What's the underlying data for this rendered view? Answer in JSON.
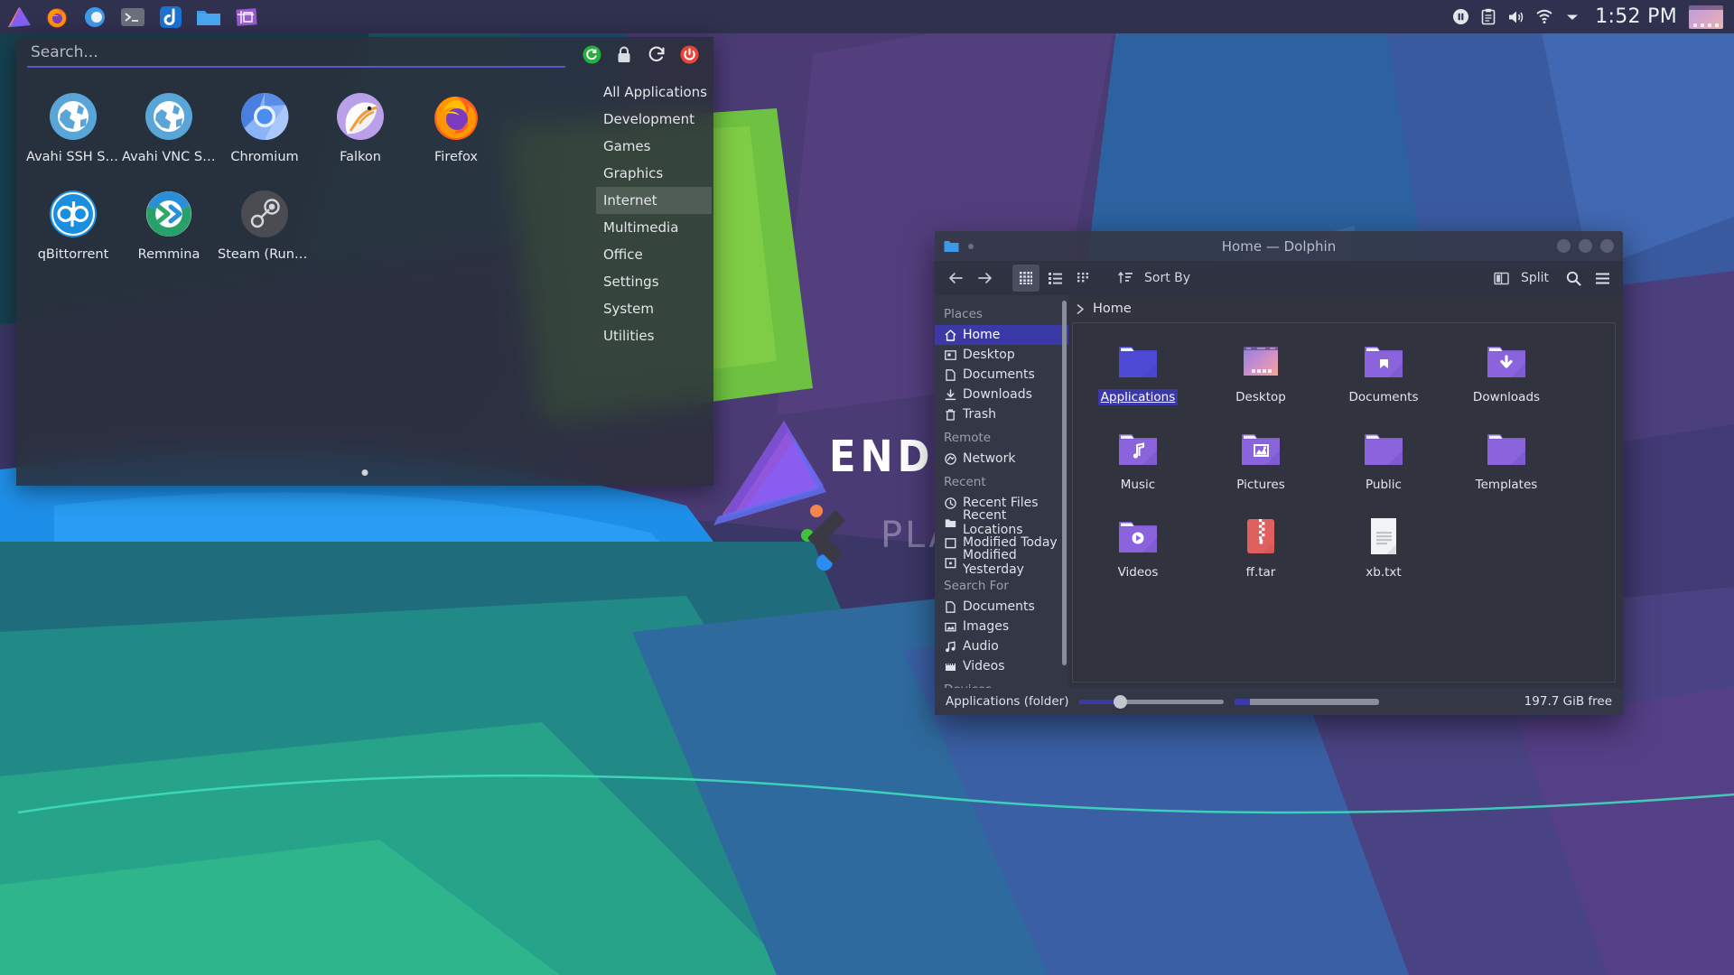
{
  "panel": {
    "task_buttons": [
      {
        "name": "endeavouros-logo",
        "label": "EndeavourOS"
      },
      {
        "name": "firefox",
        "label": "Firefox"
      },
      {
        "name": "generic-blue-circle",
        "label": "Application"
      },
      {
        "name": "terminal",
        "label": "Terminal"
      },
      {
        "name": "joplin",
        "label": "Joplin"
      },
      {
        "name": "file-manager",
        "label": "Dolphin"
      },
      {
        "name": "screenshot-tool",
        "label": "Spectacle"
      }
    ],
    "tray_icons": [
      "pause-icon",
      "clipboard-icon",
      "volume-icon",
      "wifi-icon",
      "chevron-down-icon"
    ],
    "clock": "1:52 PM"
  },
  "launcher": {
    "search": {
      "placeholder": "Search...",
      "value": ""
    },
    "session_buttons": [
      {
        "name": "switch-user-button",
        "label": "Switch User",
        "color": "#27ae3e"
      },
      {
        "name": "lock-screen-button",
        "label": "Lock",
        "color": "#d8dbe2"
      },
      {
        "name": "restart-button",
        "label": "Restart",
        "color": "#e8eaef"
      },
      {
        "name": "shutdown-button",
        "label": "Shut Down",
        "color": "#e8443a"
      }
    ],
    "apps": [
      {
        "label": "Avahi SSH Ser...",
        "icon": "globe-icon"
      },
      {
        "label": "Avahi VNC Ser...",
        "icon": "globe-icon"
      },
      {
        "label": "Chromium",
        "icon": "chromium-icon"
      },
      {
        "label": "Falkon",
        "icon": "falkon-icon"
      },
      {
        "label": "Firefox",
        "icon": "firefox-icon"
      },
      {
        "label": "qBittorrent",
        "icon": "qbittorrent-icon"
      },
      {
        "label": "Remmina",
        "icon": "remmina-icon"
      },
      {
        "label": "Steam (Runti...",
        "icon": "steam-icon"
      }
    ],
    "categories": [
      {
        "label": "All Applications",
        "selected": false
      },
      {
        "label": "Development",
        "selected": false
      },
      {
        "label": "Games",
        "selected": false
      },
      {
        "label": "Graphics",
        "selected": false
      },
      {
        "label": "Internet",
        "selected": true
      },
      {
        "label": "Multimedia",
        "selected": false
      },
      {
        "label": "Office",
        "selected": false
      },
      {
        "label": "Settings",
        "selected": false
      },
      {
        "label": "System",
        "selected": false
      },
      {
        "label": "Utilities",
        "selected": false
      }
    ]
  },
  "dolphin": {
    "title": "Home — Dolphin",
    "toolbar": {
      "sort_by": "Sort By",
      "split": "Split"
    },
    "breadcrumb": "Home",
    "sidebar": {
      "sections": [
        {
          "heading": "Places",
          "items": [
            {
              "label": "Home",
              "icon": "home-icon",
              "selected": true
            },
            {
              "label": "Desktop",
              "icon": "desktop-icon",
              "selected": false
            },
            {
              "label": "Documents",
              "icon": "document-icon",
              "selected": false
            },
            {
              "label": "Downloads",
              "icon": "download-icon",
              "selected": false
            },
            {
              "label": "Trash",
              "icon": "trash-icon",
              "selected": false
            }
          ]
        },
        {
          "heading": "Remote",
          "items": [
            {
              "label": "Network",
              "icon": "network-icon",
              "selected": false
            }
          ]
        },
        {
          "heading": "Recent",
          "items": [
            {
              "label": "Recent Files",
              "icon": "clock-icon",
              "selected": false
            },
            {
              "label": "Recent Locations",
              "icon": "folder-icon",
              "selected": false
            },
            {
              "label": "Modified Today",
              "icon": "calendar-icon",
              "selected": false
            },
            {
              "label": "Modified Yesterday",
              "icon": "calendar-dot-icon",
              "selected": false
            }
          ]
        },
        {
          "heading": "Search For",
          "items": [
            {
              "label": "Documents",
              "icon": "document-icon",
              "selected": false
            },
            {
              "label": "Images",
              "icon": "image-icon",
              "selected": false
            },
            {
              "label": "Audio",
              "icon": "audio-icon",
              "selected": false
            },
            {
              "label": "Videos",
              "icon": "video-icon",
              "selected": false
            }
          ]
        },
        {
          "heading": "Devices",
          "items": []
        }
      ]
    },
    "files": [
      {
        "label": "Applications",
        "type": "folder-blue",
        "selected": true
      },
      {
        "label": "Desktop",
        "type": "folder-desktop",
        "selected": false
      },
      {
        "label": "Documents",
        "type": "folder-documents",
        "selected": false
      },
      {
        "label": "Downloads",
        "type": "folder-downloads",
        "selected": false
      },
      {
        "label": "Music",
        "type": "folder-music",
        "selected": false
      },
      {
        "label": "Pictures",
        "type": "folder-pictures",
        "selected": false
      },
      {
        "label": "Public",
        "type": "folder-plain",
        "selected": false
      },
      {
        "label": "Templates",
        "type": "folder-plain",
        "selected": false
      },
      {
        "label": "Videos",
        "type": "folder-videos",
        "selected": false
      },
      {
        "label": "ff.tar",
        "type": "archive",
        "selected": false
      },
      {
        "label": "xb.txt",
        "type": "text",
        "selected": false
      }
    ],
    "status": {
      "selection": "Applications (folder)",
      "free_space": "197.7 GiB free"
    }
  },
  "wallpaper": {
    "brand_primary": "ENDEAVOUROS",
    "brand_secondary": "PLASMA"
  }
}
